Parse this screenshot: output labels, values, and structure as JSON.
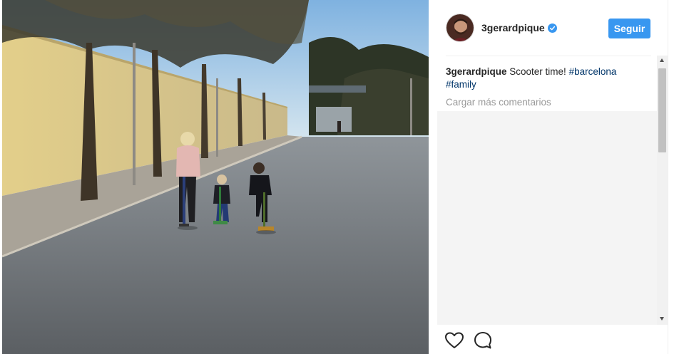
{
  "post": {
    "author": {
      "username": "3gerardpique",
      "verified": true
    },
    "follow_button_label": "Seguir",
    "caption": {
      "author": "3gerardpique",
      "text": " Scooter time! ",
      "hashtags": [
        "#barcelona",
        "#family"
      ]
    },
    "load_more_comments": "Cargar más comentarios",
    "actions": {
      "like_icon": "heart-outline",
      "comment_icon": "speech-bubble-outline"
    }
  },
  "colors": {
    "follow_button": "#3897f0",
    "hashtag": "#003569",
    "muted_text": "#999999"
  }
}
